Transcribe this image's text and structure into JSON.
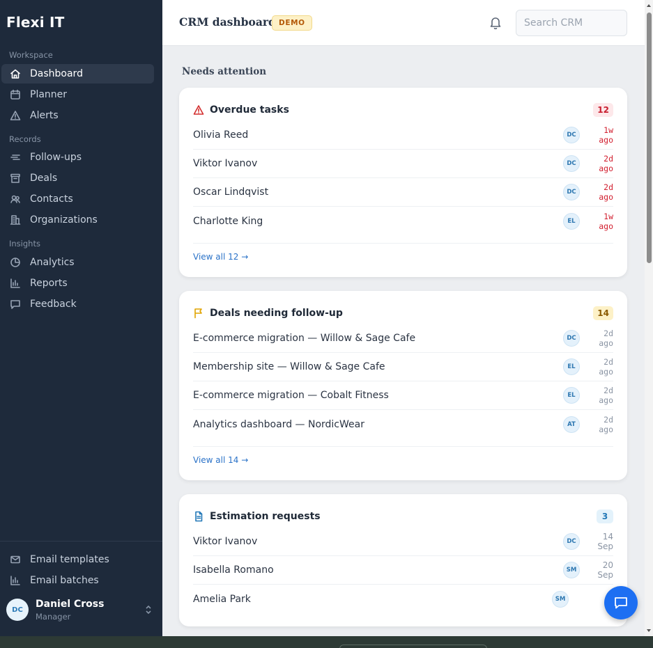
{
  "brand": "Flexi IT",
  "sidebar": {
    "sections": [
      {
        "label": "Workspace",
        "items": [
          {
            "label": "Dashboard",
            "icon": "home-icon",
            "active": true
          },
          {
            "label": "Planner",
            "icon": "calendar-icon"
          },
          {
            "label": "Alerts",
            "icon": "alert-triangle-icon"
          }
        ]
      },
      {
        "label": "Records",
        "items": [
          {
            "label": "Follow-ups",
            "icon": "list-icon"
          },
          {
            "label": "Deals",
            "icon": "archive-icon"
          },
          {
            "label": "Contacts",
            "icon": "users-icon"
          },
          {
            "label": "Organizations",
            "icon": "building-icon"
          }
        ]
      },
      {
        "label": "Insights",
        "items": [
          {
            "label": "Analytics",
            "icon": "pie-chart-icon"
          },
          {
            "label": "Reports",
            "icon": "bar-chart-icon"
          },
          {
            "label": "Feedback",
            "icon": "message-icon"
          }
        ]
      }
    ],
    "bottom_items": [
      {
        "label": "Email templates",
        "icon": "mail-icon"
      },
      {
        "label": "Email batches",
        "icon": "bar-chart-icon"
      }
    ],
    "user": {
      "initials": "DC",
      "name": "Daniel Cross",
      "role": "Manager"
    }
  },
  "header": {
    "title": "CRM dashboard",
    "badge": "DEMO",
    "search_placeholder": "Search CRM"
  },
  "section_title": "Needs attention",
  "cards": {
    "overdue": {
      "title": "Overdue tasks",
      "count": "12",
      "icon": "alert-triangle-icon",
      "accent": "#d32f2f",
      "rows": [
        {
          "name": "Olivia Reed",
          "initials": "DC",
          "age": "1w ago"
        },
        {
          "name": "Viktor Ivanov",
          "initials": "DC",
          "age": "2d ago"
        },
        {
          "name": "Oscar Lindqvist",
          "initials": "DC",
          "age": "2d ago"
        },
        {
          "name": "Charlotte King",
          "initials": "EL",
          "age": "1w ago"
        }
      ],
      "view_all": "View all 12 →"
    },
    "deals": {
      "title": "Deals needing follow-up",
      "count": "14",
      "icon": "flag-icon",
      "accent": "#e0a300",
      "rows": [
        {
          "name": "E-commerce migration — Willow & Sage Cafe",
          "initials": "DC",
          "age": "2d ago"
        },
        {
          "name": "Membership site — Willow & Sage Cafe",
          "initials": "EL",
          "age": "2d ago"
        },
        {
          "name": "E-commerce migration — Cobalt Fitness",
          "initials": "EL",
          "age": "2d ago"
        },
        {
          "name": "Analytics dashboard — NordicWear",
          "initials": "AT",
          "age": "2d ago"
        }
      ],
      "view_all": "View all 14 →"
    },
    "estimation": {
      "title": "Estimation requests",
      "count": "3",
      "icon": "document-icon",
      "accent": "#2479b8",
      "rows": [
        {
          "name": "Viktor Ivanov",
          "initials": "DC",
          "date": "14 Sep"
        },
        {
          "name": "Isabella Romano",
          "initials": "SM",
          "date": "20 Sep"
        },
        {
          "name": "Amelia Park",
          "initials": "SM",
          "date": ""
        }
      ]
    }
  },
  "colors": {
    "sidebar_bg": "#1e2a3b",
    "accent_blue": "#1d6ff2",
    "link": "#2a72c8",
    "overdue_red": "#d21f2f"
  }
}
